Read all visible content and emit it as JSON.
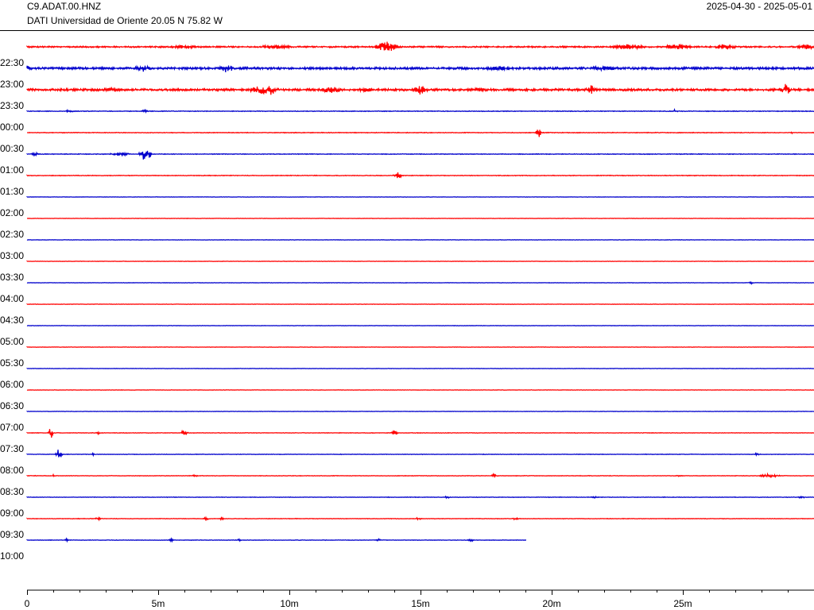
{
  "header": {
    "station": "C9.ADAT.00.HNZ",
    "location": "DATI Universidad de Oriente  20.05 N 75.82 W",
    "date_range": "2025-04-30 - 2025-05-01"
  },
  "colors": {
    "red": "#ff0000",
    "blue": "#0000cc",
    "axis": "#000000"
  },
  "chart_data": {
    "type": "line",
    "title": "",
    "subtitle": "",
    "xlabel": "",
    "ylabel": "",
    "xlim_minutes": [
      0,
      30
    ],
    "x_ticks": [
      {
        "value": 0,
        "label": "0"
      },
      {
        "value": 5,
        "label": "5m"
      },
      {
        "value": 10,
        "label": "10m"
      },
      {
        "value": 15,
        "label": "15m"
      },
      {
        "value": 20,
        "label": "20m"
      },
      {
        "value": 25,
        "label": "25m"
      }
    ],
    "time_labels": [
      "22:30",
      "23:00",
      "23:30",
      "00:00",
      "00:30",
      "01:00",
      "01:30",
      "02:00",
      "02:30",
      "03:00",
      "03:30",
      "04:00",
      "04:30",
      "05:00",
      "05:30",
      "06:00",
      "06:30",
      "07:00",
      "07:30",
      "08:00",
      "08:30",
      "09:00",
      "09:30",
      "10:00"
    ],
    "grid": false,
    "traces": [
      {
        "color": "red",
        "end_min": 30,
        "noise": 2,
        "events": [
          [
            6,
            1.5,
            3
          ],
          [
            9.4,
            2,
            3
          ],
          [
            13.7,
            1.2,
            7
          ],
          [
            22.9,
            1.8,
            4
          ],
          [
            24.8,
            1.5,
            4
          ],
          [
            26.6,
            1.2,
            4
          ],
          [
            29.7,
            1.2,
            3
          ]
        ]
      },
      {
        "color": "blue",
        "end_min": 30,
        "noise": 3,
        "events": [
          [
            0,
            0.5,
            5
          ],
          [
            4.4,
            0.8,
            5
          ],
          [
            7.6,
            0.8,
            6
          ],
          [
            18,
            2,
            3
          ],
          [
            22,
            2,
            3
          ]
        ]
      },
      {
        "color": "red",
        "end_min": 30,
        "noise": 3,
        "events": [
          [
            3.2,
            1,
            3
          ],
          [
            9,
            1.6,
            6
          ],
          [
            9.3,
            0.4,
            8
          ],
          [
            11.6,
            1.2,
            5
          ],
          [
            12.9,
            1.2,
            3
          ],
          [
            15,
            0.6,
            8
          ],
          [
            17.2,
            1,
            3
          ],
          [
            21.5,
            0.6,
            6
          ],
          [
            28.9,
            0.5,
            8
          ]
        ]
      },
      {
        "color": "blue",
        "end_min": 30,
        "noise": 1,
        "events": [
          [
            1.6,
            0.4,
            2
          ],
          [
            4.5,
            0.4,
            2
          ],
          [
            24.7,
            0.2,
            3
          ]
        ]
      },
      {
        "color": "red",
        "end_min": 30,
        "noise": 1,
        "events": [
          [
            19.5,
            0.3,
            6
          ],
          [
            29.1,
            0.2,
            2
          ]
        ]
      },
      {
        "color": "blue",
        "end_min": 30,
        "noise": 1,
        "events": [
          [
            0.3,
            0.3,
            6
          ],
          [
            3.5,
            1,
            3
          ],
          [
            4.5,
            0.6,
            10
          ]
        ]
      },
      {
        "color": "red",
        "end_min": 30,
        "noise": 1,
        "events": [
          [
            14.1,
            0.4,
            5
          ]
        ]
      },
      {
        "color": "blue",
        "end_min": 30,
        "noise": 0.6,
        "events": []
      },
      {
        "color": "red",
        "end_min": 30,
        "noise": 0.6,
        "events": []
      },
      {
        "color": "blue",
        "end_min": 30,
        "noise": 0.6,
        "events": []
      },
      {
        "color": "red",
        "end_min": 30,
        "noise": 0.6,
        "events": []
      },
      {
        "color": "blue",
        "end_min": 30,
        "noise": 0.6,
        "events": [
          [
            27.6,
            0.2,
            2
          ]
        ]
      },
      {
        "color": "red",
        "end_min": 30,
        "noise": 0.6,
        "events": []
      },
      {
        "color": "blue",
        "end_min": 30,
        "noise": 0.6,
        "events": []
      },
      {
        "color": "red",
        "end_min": 30,
        "noise": 0.6,
        "events": []
      },
      {
        "color": "blue",
        "end_min": 30,
        "noise": 0.6,
        "events": []
      },
      {
        "color": "red",
        "end_min": 30,
        "noise": 0.6,
        "events": []
      },
      {
        "color": "blue",
        "end_min": 30,
        "noise": 0.6,
        "events": []
      },
      {
        "color": "red",
        "end_min": 30,
        "noise": 0.8,
        "events": [
          [
            0.9,
            0.2,
            8
          ],
          [
            2.7,
            0.3,
            2
          ],
          [
            6,
            0.4,
            4
          ],
          [
            14,
            0.3,
            3
          ]
        ]
      },
      {
        "color": "blue",
        "end_min": 30,
        "noise": 0.8,
        "events": [
          [
            1.2,
            0.3,
            7
          ],
          [
            2.5,
            0.2,
            2
          ],
          [
            27.8,
            0.2,
            2
          ]
        ]
      },
      {
        "color": "red",
        "end_min": 30,
        "noise": 0.8,
        "events": [
          [
            1,
            0.2,
            2
          ],
          [
            6.4,
            0.3,
            2
          ],
          [
            17.8,
            0.3,
            3
          ],
          [
            24.8,
            0.3,
            2
          ],
          [
            28.3,
            1,
            3
          ]
        ]
      },
      {
        "color": "blue",
        "end_min": 30,
        "noise": 0.8,
        "events": [
          [
            16,
            0.3,
            2
          ],
          [
            21.6,
            0.3,
            2
          ],
          [
            29.5,
            0.3,
            2
          ]
        ]
      },
      {
        "color": "red",
        "end_min": 30,
        "noise": 0.8,
        "events": [
          [
            2.7,
            0.3,
            2
          ],
          [
            6.8,
            0.3,
            2
          ],
          [
            7.4,
            0.3,
            2
          ],
          [
            14.9,
            0.3,
            2
          ],
          [
            18.6,
            0.3,
            2
          ]
        ]
      },
      {
        "color": "blue",
        "end_min": 19,
        "noise": 0.8,
        "events": [
          [
            1.5,
            0.2,
            2
          ],
          [
            5.5,
            0.3,
            2
          ],
          [
            8.1,
            0.2,
            2
          ],
          [
            13.4,
            0.3,
            2
          ],
          [
            16.9,
            0.3,
            2
          ]
        ]
      }
    ]
  }
}
